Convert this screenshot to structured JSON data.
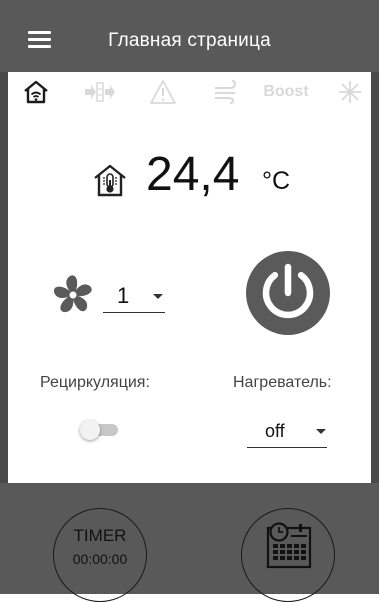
{
  "header": {
    "title": "Главная страница",
    "menu_icon": "hamburger-menu-icon"
  },
  "status_icons": [
    {
      "name": "home-wifi-icon",
      "active": true
    },
    {
      "name": "filter-icon",
      "active": false
    },
    {
      "name": "warning-icon",
      "active": false
    },
    {
      "name": "wind-icon",
      "active": false
    },
    {
      "name": "boost",
      "label": "Boost",
      "active": false
    },
    {
      "name": "snowflake-icon",
      "active": false
    }
  ],
  "temperature": {
    "value": "24,4",
    "unit": "°C",
    "icon": "home-thermometer-icon"
  },
  "fan": {
    "icon": "fan-icon",
    "speed": "1"
  },
  "power": {
    "icon": "power-icon"
  },
  "recirculation": {
    "label": "Рециркуляция:",
    "enabled": false
  },
  "heater": {
    "label": "Нагреватель:",
    "value": "off"
  },
  "timer": {
    "label": "TIMER",
    "time": "00:00:00"
  },
  "schedule": {
    "icon": "calendar-clock-icon"
  },
  "colors": {
    "bar": "#595959",
    "frame": "#4a4a4a",
    "icon_dark": "#5a5a5a",
    "icon_inactive": "#d9d9d9"
  }
}
